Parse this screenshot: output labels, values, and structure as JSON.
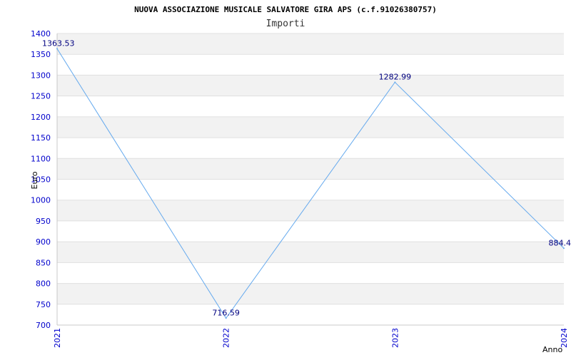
{
  "chart_data": {
    "type": "line",
    "title": "NUOVA ASSOCIAZIONE MUSICALE SALVATORE GIRA APS (c.f.91026380757)",
    "subtitle": "Importi",
    "xlabel": "Anno",
    "ylabel": "Euro",
    "categories": [
      "2021",
      "2022",
      "2023",
      "2024"
    ],
    "values": [
      1363.53,
      716.59,
      1282.99,
      884.4
    ],
    "value_labels": [
      "1363.53",
      "716.59",
      "1282.99",
      "884.4"
    ],
    "y_ticks": [
      "700",
      "750",
      "800",
      "850",
      "900",
      "950",
      "1000",
      "1050",
      "1100",
      "1150",
      "1200",
      "1250",
      "1300",
      "1350",
      "1400"
    ],
    "ylim": [
      700,
      1400
    ],
    "grid": true,
    "line_color": "#66aaee",
    "tick_color": "#0000cc",
    "label_color": "#000080",
    "band_color": "#f2f2f2"
  }
}
